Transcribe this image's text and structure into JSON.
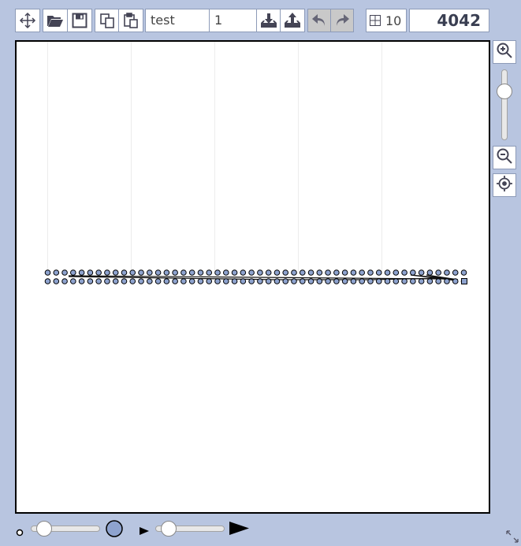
{
  "toolbar": {
    "name_value": "test",
    "number_value": "1",
    "grid_size": "10",
    "counter": "4042"
  },
  "zoom": {
    "level": 0.25
  },
  "bottom": {
    "point_size": 0.1,
    "speed": 0.1
  },
  "colors": {
    "accent": "#8ea3cf",
    "frame": "#b8c5e0",
    "border": "#8d9bb8"
  }
}
